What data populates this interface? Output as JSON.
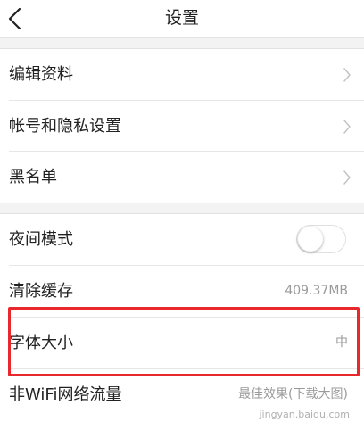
{
  "navbar": {
    "back_icon": "chevron-left-icon",
    "title": "设置"
  },
  "group1": {
    "items": [
      {
        "label": "编辑资料",
        "icon": "chevron-right-icon"
      },
      {
        "label": "帐号和隐私设置",
        "icon": "chevron-right-icon"
      },
      {
        "label": "黑名单",
        "icon": "chevron-right-icon"
      }
    ]
  },
  "group2": {
    "night_mode": {
      "label": "夜间模式",
      "toggle_on": false
    },
    "clear_cache": {
      "label": "清除缓存",
      "value": "409.37MB"
    },
    "font_size": {
      "label": "字体大小",
      "value": "中"
    },
    "non_wifi": {
      "label": "非WiFi网络流量",
      "value": "最佳效果(下载大图)"
    }
  },
  "annotation": {
    "highlight_color": "#e8282d",
    "watermark": "jingyan.baidu.com"
  },
  "colors": {
    "background": "#f3f3f3",
    "surface": "#ffffff",
    "text": "#222222",
    "secondary_text": "#9a9a9a"
  }
}
